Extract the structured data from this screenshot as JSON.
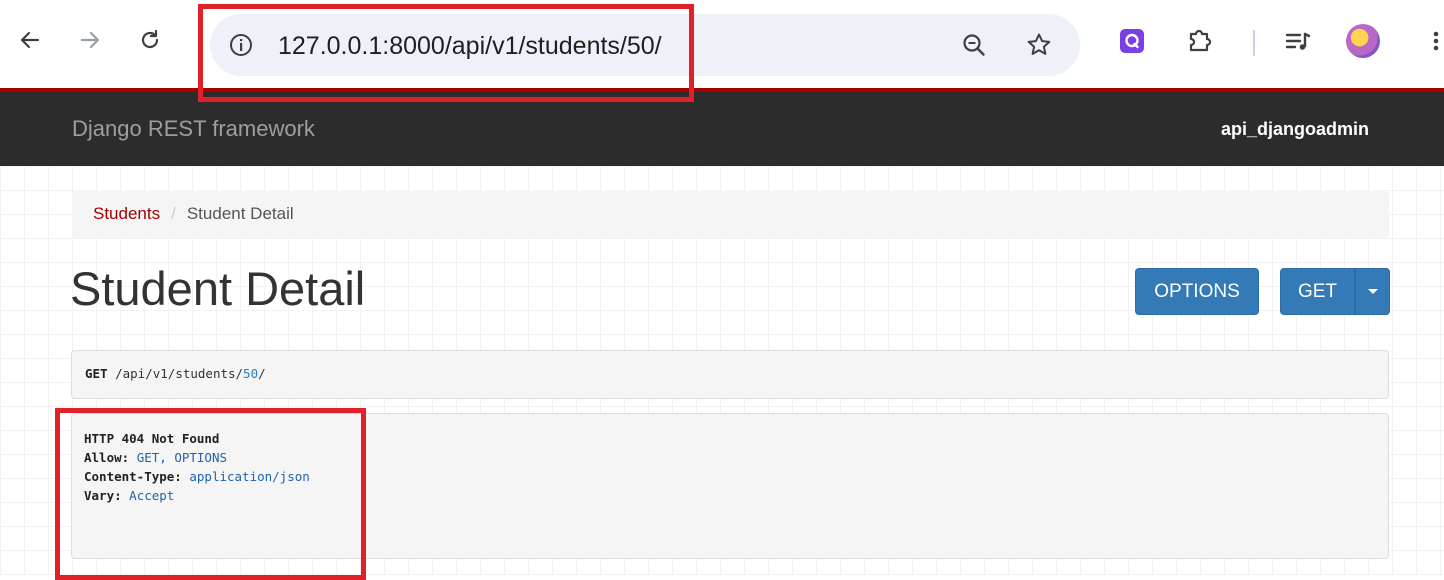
{
  "browser": {
    "url": "127.0.0.1:8000/api/v1/students/50/",
    "icons": [
      "back-arrow-icon",
      "forward-arrow-icon",
      "reload-icon",
      "info-icon",
      "zoom-icon",
      "star-icon",
      "q-extension-icon",
      "extensions-puzzle-icon",
      "reading-list-icon",
      "profile-avatar",
      "more-menu-icon"
    ]
  },
  "navbar": {
    "brand": "Django REST framework",
    "user": "api_djangoadmin"
  },
  "breadcrumb": {
    "link": "Students",
    "separator": "/",
    "active": "Student Detail"
  },
  "page": {
    "title": "Student Detail"
  },
  "buttons": {
    "options": "OPTIONS",
    "get": "GET"
  },
  "request": {
    "method": "GET",
    "path_prefix": "/api/v1/students/",
    "path_id": "50",
    "path_suffix": "/"
  },
  "response": {
    "status": "HTTP 404 Not Found",
    "headers": [
      {
        "key": "Allow:",
        "value": "GET, OPTIONS"
      },
      {
        "key": "Content-Type:",
        "value": "application/json"
      },
      {
        "key": "Vary:",
        "value": "Accept"
      }
    ]
  },
  "colors": {
    "highlight": "#e02127",
    "navbar_bg": "#2c2c2c",
    "navbar_accent": "#a30000",
    "button_primary": "#337ab7",
    "link": "#a30000"
  }
}
